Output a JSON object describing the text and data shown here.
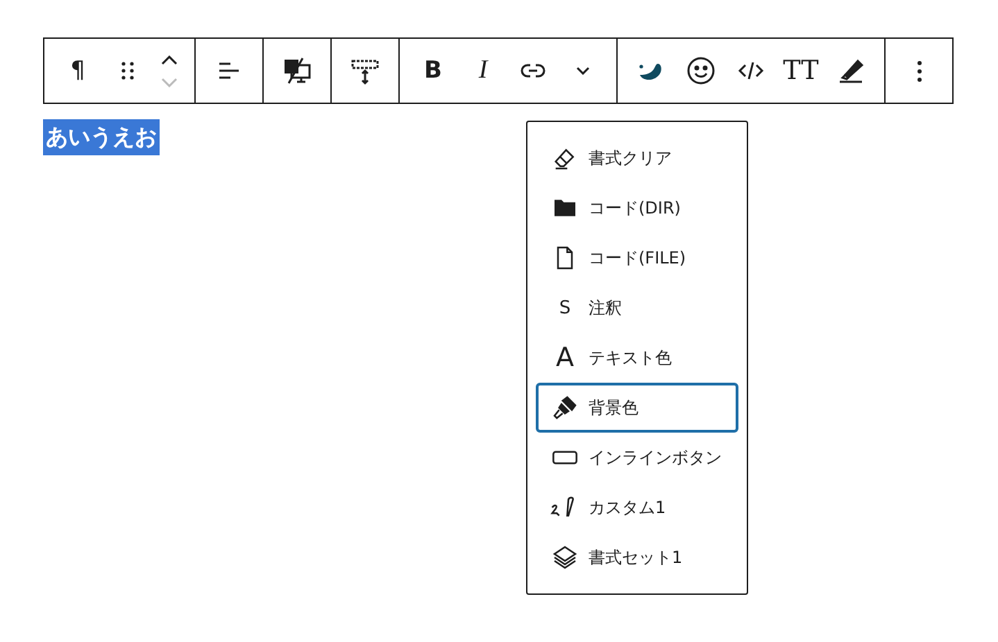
{
  "toolbar": {
    "groups": [
      [
        {
          "kind": "paragraph",
          "label": "¶"
        },
        {
          "kind": "drag"
        },
        {
          "kind": "movers",
          "up_disabled": false,
          "down_disabled": true
        }
      ],
      [
        {
          "kind": "align"
        }
      ],
      [
        {
          "kind": "devices"
        }
      ],
      [
        {
          "kind": "spacing"
        }
      ],
      [
        {
          "kind": "bold",
          "label": "B"
        },
        {
          "kind": "italic",
          "label": "I"
        },
        {
          "kind": "link"
        },
        {
          "kind": "chevron"
        }
      ],
      [
        {
          "kind": "drop"
        },
        {
          "kind": "smiley"
        },
        {
          "kind": "code"
        },
        {
          "kind": "font-size",
          "label": "TT"
        },
        {
          "kind": "marker"
        }
      ],
      [
        {
          "kind": "more"
        }
      ]
    ]
  },
  "content": {
    "selected_text": "あいうえお"
  },
  "dropdown": {
    "items": [
      {
        "label": "書式クリア",
        "selected": false
      },
      {
        "label": "コード(DIR)",
        "selected": false
      },
      {
        "label": "コード(FILE)",
        "selected": false
      },
      {
        "glyph": "S",
        "label": "注釈",
        "selected": false
      },
      {
        "glyph": "A",
        "label": "テキスト色",
        "selected": false
      },
      {
        "label": "背景色",
        "selected": true
      },
      {
        "label": "インラインボタン",
        "selected": false
      },
      {
        "label": "カスタム1",
        "selected": false
      },
      {
        "label": "書式セット1",
        "selected": false
      }
    ]
  }
}
